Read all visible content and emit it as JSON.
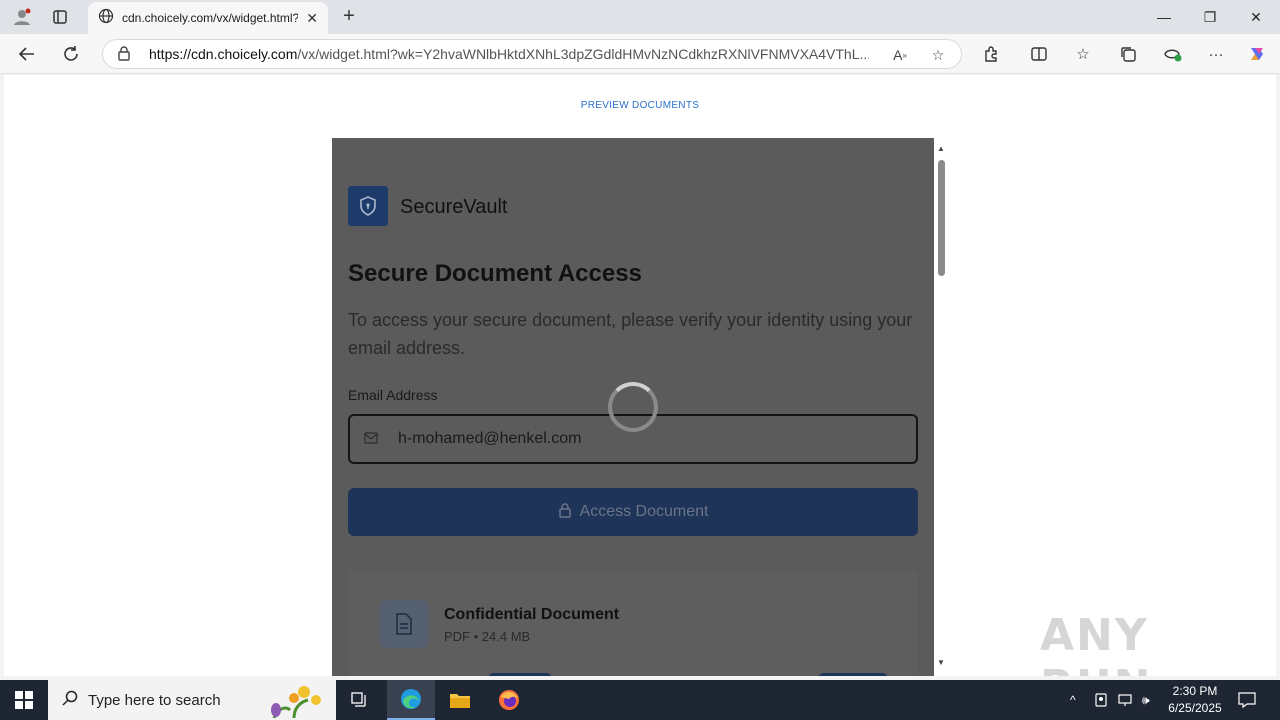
{
  "browser": {
    "tab_title": "cdn.choicely.com/vx/widget.html?",
    "url_host": "https://cdn.choicely.com",
    "url_path": "/vx/widget.html?wk=Y2hvaWNlbHktdXNhL3dpZGdldHMvNzNCdkhzRXNlVFNMVXA4VThL..."
  },
  "page": {
    "preview_link": "PREVIEW DOCUMENTS",
    "brand": "SecureVault",
    "heading": "Secure Document Access",
    "description": "To access your secure document, please verify your identity using your email address.",
    "email_label": "Email Address",
    "email_value": "h-mohamed@henkel.com",
    "access_button": "Access Document",
    "document": {
      "name": "Confidential Document",
      "meta": "PDF • 24.4 MB"
    }
  },
  "watermark": "ANY RUN",
  "taskbar": {
    "search_placeholder": "Type here to search",
    "time": "2:30 PM",
    "date": "6/25/2025"
  },
  "colors": {
    "brand_blue": "#1d3a6b",
    "overlay_gray": "#5b5b5b",
    "link_blue": "#2a6fc9"
  }
}
